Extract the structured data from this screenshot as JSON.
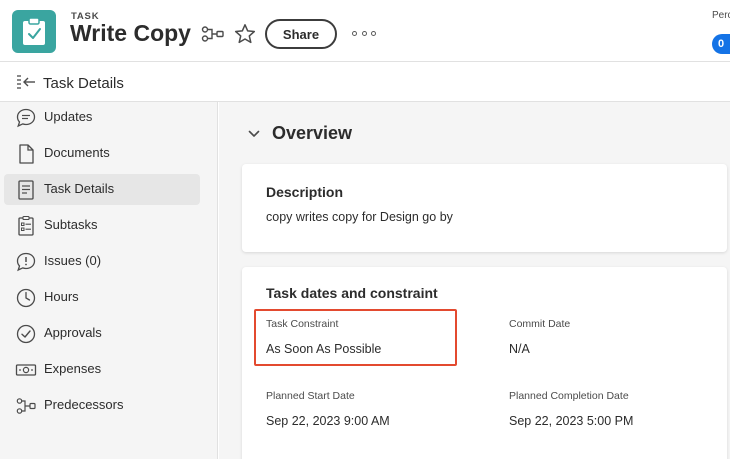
{
  "header": {
    "type_label": "TASK",
    "title": "Write Copy",
    "share_label": "Share",
    "percent_label": "Perc",
    "pill_text": "0",
    "icons": [
      "clipboard-check-icon",
      "workflow-icon",
      "star-icon",
      "more-icon"
    ]
  },
  "subheader": {
    "title": "Task Details",
    "icon": "collapse-panel-icon"
  },
  "sidebar": {
    "items": [
      {
        "label": "Updates",
        "icon": "chat-bubble-icon",
        "active": false
      },
      {
        "label": "Documents",
        "icon": "document-icon",
        "active": false
      },
      {
        "label": "Task Details",
        "icon": "details-icon",
        "active": true
      },
      {
        "label": "Subtasks",
        "icon": "subtasks-icon",
        "active": false
      },
      {
        "label": "Issues (0)",
        "icon": "issue-icon",
        "active": false
      },
      {
        "label": "Hours",
        "icon": "clock-icon",
        "active": false
      },
      {
        "label": "Approvals",
        "icon": "check-circle-icon",
        "active": false
      },
      {
        "label": "Expenses",
        "icon": "money-icon",
        "active": false
      },
      {
        "label": "Predecessors",
        "icon": "predecessors-icon",
        "active": false
      }
    ]
  },
  "main": {
    "section_title": "Overview",
    "description": {
      "title": "Description",
      "text": "copy writes copy for Design go by"
    },
    "dates": {
      "title": "Task dates and constraint",
      "task_constraint_label": "Task Constraint",
      "task_constraint_value": "As Soon As Possible",
      "commit_date_label": "Commit Date",
      "commit_date_value": "N/A",
      "planned_start_label": "Planned Start Date",
      "planned_start_value": "Sep 22, 2023 9:00 AM",
      "planned_completion_label": "Planned Completion Date",
      "planned_completion_value": "Sep 22, 2023 5:00 PM"
    }
  },
  "colors": {
    "task_icon_bg": "#3aa5a0",
    "highlight": "#e34a2f",
    "accent_blue": "#1473e6"
  }
}
